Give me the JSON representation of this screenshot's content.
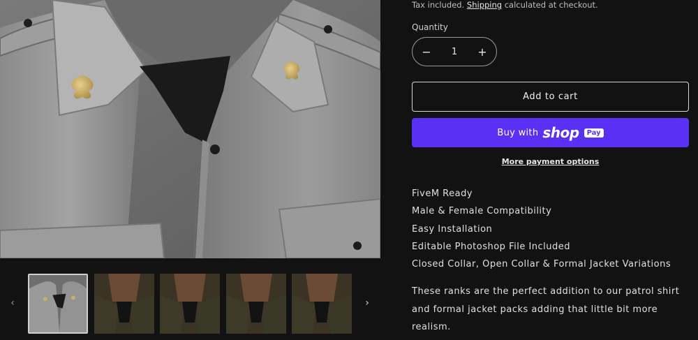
{
  "product": {
    "tax_note_prefix": "Tax included.",
    "tax_note_link": "Shipping",
    "tax_note_suffix": "calculated at checkout.",
    "quantity_label": "Quantity",
    "quantity_value": "1",
    "decrease_icon": "minus-icon",
    "increase_icon": "plus-icon",
    "add_to_cart_label": "Add to cart",
    "buy_with_label": "Buy with",
    "shop_word": "shop",
    "pay_badge": "Pay",
    "more_payment_label": "More payment options",
    "features": [
      "FiveM Ready",
      "Male & Female Compatibility",
      "Easy Installation",
      "Editable Photoshop File Included",
      "Closed Collar, Open Collar & Formal Jacket Variations"
    ],
    "description": "These ranks are the perfect addition to our patrol shirt and formal jacket packs adding that little bit more realism."
  },
  "gallery": {
    "prev_icon": "chevron-left-icon",
    "next_icon": "chevron-right-icon",
    "thumbnails": [
      {
        "variant": "grey-shirt",
        "active": true
      },
      {
        "variant": "olive-jacket",
        "active": false
      },
      {
        "variant": "olive-jacket",
        "active": false
      },
      {
        "variant": "olive-jacket",
        "active": false
      },
      {
        "variant": "olive-jacket",
        "active": false
      }
    ]
  },
  "colors": {
    "background": "#121212",
    "accent_shop_pay": "#5a31f4",
    "text": "#e6e6e6"
  }
}
